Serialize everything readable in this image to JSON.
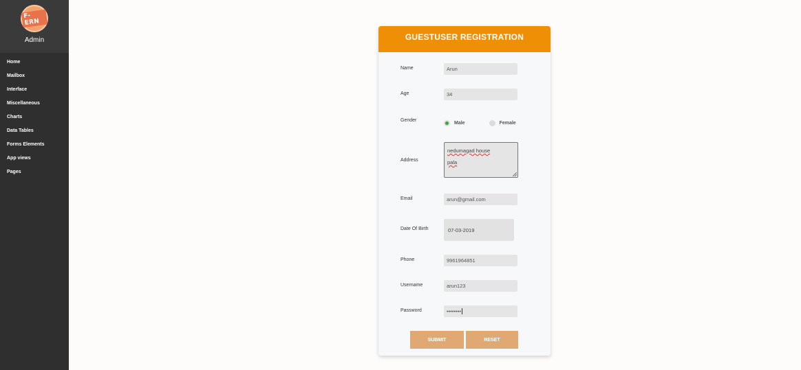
{
  "sidebar": {
    "logo_text": "F-ERN",
    "user_label": "Admin",
    "items": [
      {
        "label": "Home"
      },
      {
        "label": "Mailbox"
      },
      {
        "label": "Interface"
      },
      {
        "label": "Miscellaneous"
      },
      {
        "label": "Charts"
      },
      {
        "label": "Data Tables"
      },
      {
        "label": "Forms Elements"
      },
      {
        "label": "App views"
      },
      {
        "label": "Pages"
      }
    ]
  },
  "form": {
    "title": "GUESTUSER REGISTRATION",
    "accent_color": "#ee8f05",
    "name": {
      "label": "Name",
      "value": "Arun"
    },
    "age": {
      "label": "Age",
      "value": "34"
    },
    "gender": {
      "label": "Gender",
      "options": [
        "Male",
        "Female"
      ],
      "selected": "Male"
    },
    "address": {
      "label": "Address",
      "lines": [
        "nedumagad house",
        "pala"
      ]
    },
    "email": {
      "label": "Email",
      "value": "arun@gmail.com"
    },
    "dob": {
      "label": "Date Of Birth",
      "value": "07-03-2019"
    },
    "phone": {
      "label": "Phone",
      "value": "9961964851"
    },
    "username": {
      "label": "Username",
      "value": "arun123"
    },
    "password": {
      "label": "Password",
      "value": "••••••••"
    },
    "submit_label": "SUBMIT",
    "reset_label": "RESET"
  }
}
